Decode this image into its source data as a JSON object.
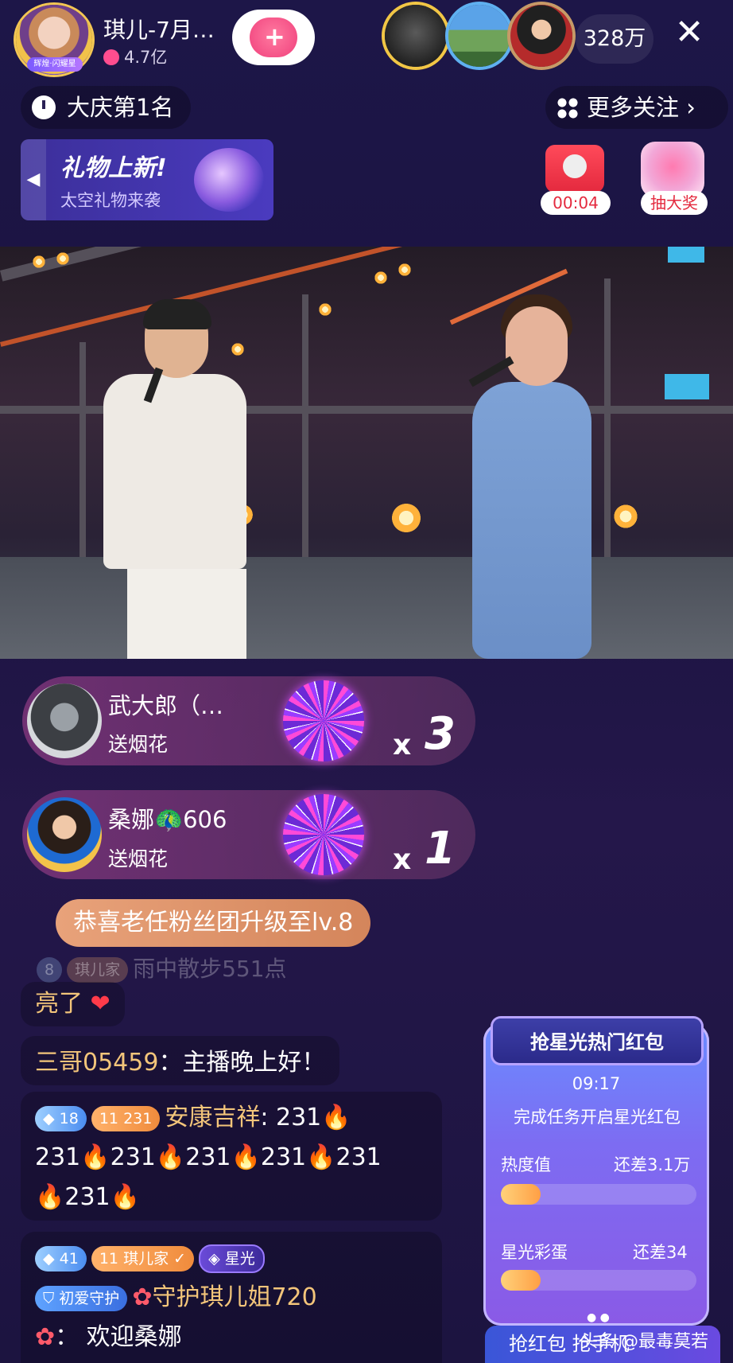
{
  "header": {
    "host_name": "琪儿-7月…",
    "host_badge": "辉煌·闪耀星",
    "host_heat": "4.7亿",
    "viewer_count": "328万",
    "close_icon": "close-icon"
  },
  "rank": {
    "label": "大庆第1名"
  },
  "more_follow": {
    "label": "更多关注"
  },
  "gift_banner": {
    "title": "礼物上新!",
    "subtitle": "太空礼物来袭"
  },
  "red_packet_timer": {
    "time": "00:04"
  },
  "lottery": {
    "label": "抽大奖"
  },
  "gifts": [
    {
      "user": "武大郎（…",
      "action": "送烟花",
      "x": "x",
      "count": "3"
    },
    {
      "user": "桑娜🦚606",
      "action": "送烟花",
      "x": "x",
      "count": "1"
    }
  ],
  "chat": {
    "upgrade": "恭喜老任粉丝团升级至lv.8",
    "faded": "雨中散步551点",
    "faded_badge_level": "8",
    "faded_badge_name": "琪儿家",
    "line1": "亮了",
    "line2_user": "三哥05459",
    "line2_text": "：主播晚上好！",
    "msg3": {
      "badge_level": "18",
      "fan_level": "11",
      "fan_value": "231",
      "user": "安康吉祥",
      "text_parts": [
        ":  231",
        "231",
        "231",
        "231",
        "231",
        "231",
        "231"
      ]
    },
    "msg4": {
      "badge_level": "41",
      "fan_level": "11",
      "fan_name": "琪儿家",
      "star_badge": "星光",
      "guard_badge": "初爱守护",
      "line2": "守护琪儿姐720",
      "line3": "：  欢迎桑娜"
    }
  },
  "red_packet": {
    "title": "抢星光热门红包",
    "time": "09:17",
    "subtitle": "完成任务开启星光红包",
    "row1_label": "热度值",
    "row1_value": "还差3.1万",
    "row2_label": "星光彩蛋",
    "row2_value": "还差34",
    "grab_button": "抢红包  抢手机"
  },
  "watermark": "头条 @最毒莫若"
}
